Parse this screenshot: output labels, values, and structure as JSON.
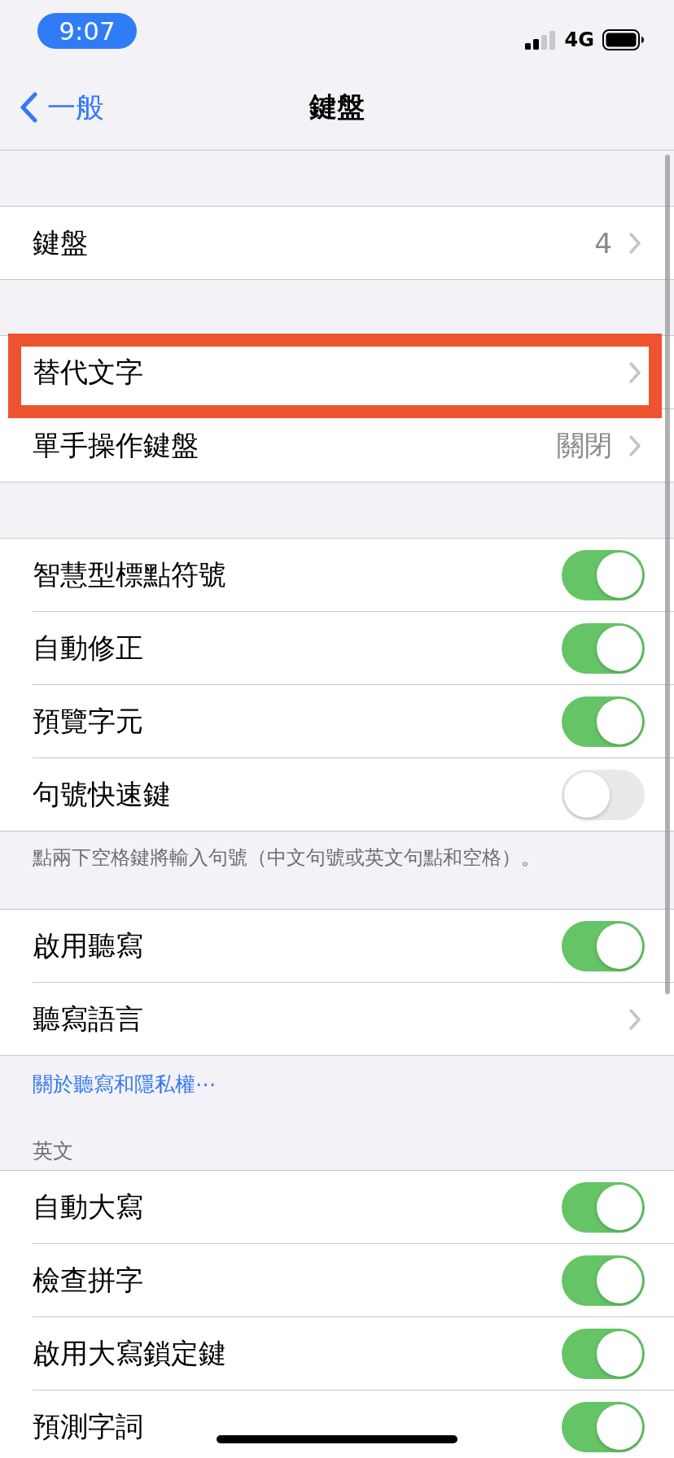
{
  "status_bar": {
    "time": "9:07",
    "network": "4G"
  },
  "nav": {
    "back": "一般",
    "title": "鍵盤"
  },
  "groups": [
    {
      "rows": [
        {
          "kind": "link",
          "label": "鍵盤",
          "value": "4",
          "highlighted": false
        }
      ]
    },
    {
      "rows": [
        {
          "kind": "link",
          "label": "替代文字",
          "highlighted": true
        },
        {
          "kind": "link",
          "label": "單手操作鍵盤",
          "value": "關閉",
          "highlighted": false
        }
      ]
    },
    {
      "rows": [
        {
          "kind": "toggle",
          "label": "智慧型標點符號",
          "on": true
        },
        {
          "kind": "toggle",
          "label": "自動修正",
          "on": true
        },
        {
          "kind": "toggle",
          "label": "預覽字元",
          "on": true
        },
        {
          "kind": "toggle",
          "label": "句號快速鍵",
          "on": false
        }
      ],
      "footer": "點兩下空格鍵將輸入句號（中文句號或英文句點和空格）。"
    },
    {
      "rows": [
        {
          "kind": "toggle",
          "label": "啟用聽寫",
          "on": true
        },
        {
          "kind": "link",
          "label": "聽寫語言",
          "highlighted": false
        }
      ],
      "link": "關於聽寫和隱私權⋯"
    },
    {
      "header": "英文",
      "rows": [
        {
          "kind": "toggle",
          "label": "自動大寫",
          "on": true
        },
        {
          "kind": "toggle",
          "label": "檢查拼字",
          "on": true
        },
        {
          "kind": "toggle",
          "label": "啟用大寫鎖定鍵",
          "on": true
        },
        {
          "kind": "toggle",
          "label": "預測字詞",
          "on": true
        }
      ]
    }
  ]
}
